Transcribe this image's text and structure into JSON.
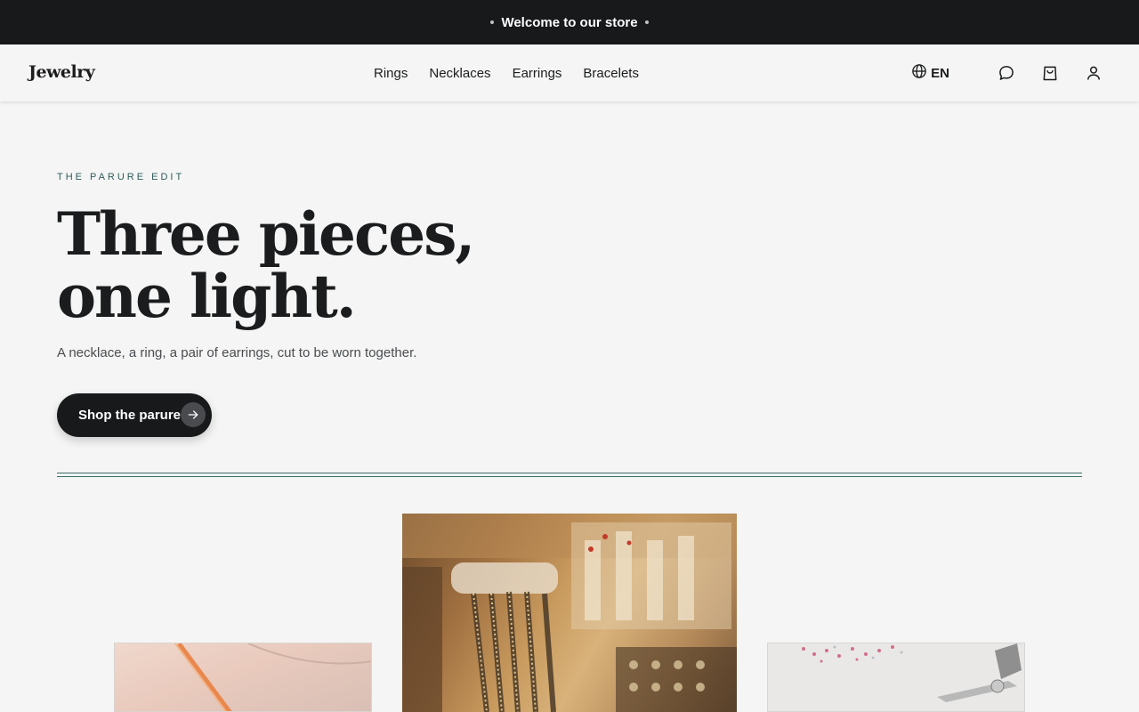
{
  "announcement": {
    "text": "Welcome to our store"
  },
  "header": {
    "logo": "Jewelry",
    "nav": [
      "Rings",
      "Necklaces",
      "Earrings",
      "Bracelets"
    ],
    "language": "EN",
    "icons": [
      "globe-icon",
      "chat-icon",
      "bag-icon",
      "user-icon"
    ]
  },
  "hero": {
    "eyebrow": "THE PARURE EDIT",
    "headline_line1": "Three pieces,",
    "headline_line2": "one light.",
    "subtitle": "A necklace, a ring, a pair of earrings, cut to be worn together.",
    "cta_label": "Shop the parure"
  },
  "colors": {
    "background": "#f4f5f4",
    "dark": "#18191b",
    "accent": "#2f5d5a"
  }
}
